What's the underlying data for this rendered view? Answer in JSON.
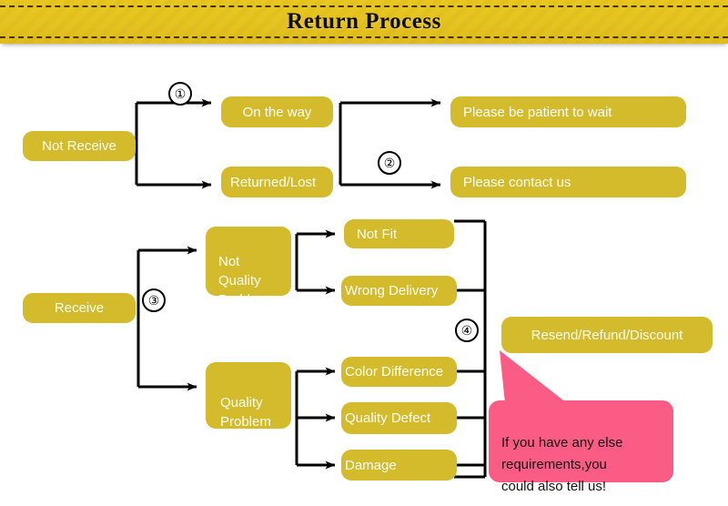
{
  "header": {
    "title": "Return Process",
    "banner_color": "#e6c420",
    "stitch_color": "#4a3207"
  },
  "theme": {
    "node_color": "#d3bb2b",
    "node_text_color": "#fdfdf7",
    "wire_color": "#000000",
    "callout_color": "#fa5c85",
    "callout_text_color": "#15120f"
  },
  "flow": {
    "nodes": [
      {
        "id": "not-receive",
        "label": "Not Receive"
      },
      {
        "id": "on-the-way",
        "label": "On the way"
      },
      {
        "id": "returned-lost",
        "label": "Returned/Lost"
      },
      {
        "id": "be-patient",
        "label": "Please be patient to wait"
      },
      {
        "id": "contact-us",
        "label": "Please contact us"
      },
      {
        "id": "receive",
        "label": "Receive"
      },
      {
        "id": "not-quality",
        "label": "Not\nQuality\nProblem"
      },
      {
        "id": "quality-problem",
        "label": "Quality\nProblem"
      },
      {
        "id": "not-fit",
        "label": "Not Fit"
      },
      {
        "id": "wrong-delivery",
        "label": "Wrong Delivery"
      },
      {
        "id": "color-diff",
        "label": "Color Difference"
      },
      {
        "id": "quality-defect",
        "label": "Quality Defect"
      },
      {
        "id": "damage",
        "label": "Damage"
      },
      {
        "id": "resolution",
        "label": "Resend/Refund/Discount"
      }
    ],
    "steps": [
      {
        "id": "step-1",
        "label": "①"
      },
      {
        "id": "step-2",
        "label": "②"
      },
      {
        "id": "step-3",
        "label": "③"
      },
      {
        "id": "step-4",
        "label": "④"
      }
    ]
  },
  "callout": {
    "text": "If you have any else\nrequirements,you\ncould also tell us!"
  }
}
